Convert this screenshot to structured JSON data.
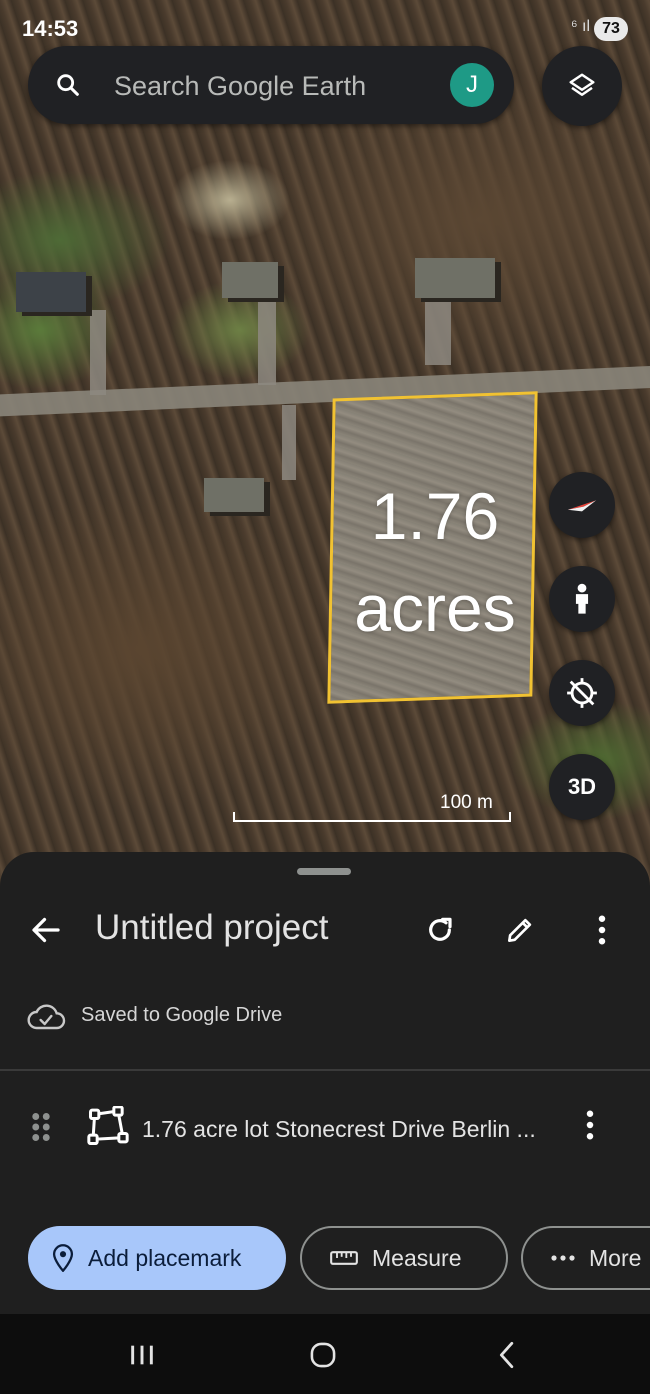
{
  "status_bar": {
    "time": "14:53",
    "signal": "⁶ ıl",
    "battery": "73"
  },
  "search": {
    "placeholder": "Search Google Earth",
    "avatar_letter": "J"
  },
  "map": {
    "lot_area_value": "1.76",
    "lot_area_unit": "acres",
    "scale_label": "100 m",
    "boundary_color": "#f1c232"
  },
  "map_controls": {
    "three_d_label": "3D"
  },
  "project": {
    "title": "Untitled project",
    "saved_status": "Saved to Google Drive",
    "items": [
      {
        "label": "1.76 acre lot Stonecrest Drive Berlin ..."
      }
    ]
  },
  "actions": {
    "add_placemark": "Add placemark",
    "measure": "Measure",
    "more": "More"
  },
  "icons": [
    "search-icon",
    "layers-icon",
    "compass-icon",
    "street-view-icon",
    "location-off-icon",
    "back-icon",
    "refresh-icon",
    "edit-icon",
    "more-vert-icon",
    "cloud-done-icon",
    "drag-handle-icon",
    "polygon-icon",
    "pin-icon",
    "ruler-icon",
    "more-horiz-icon"
  ],
  "colors": {
    "accent": "#a8c7fa",
    "avatar": "#1e9a86",
    "sheet": "#1f1f1f"
  }
}
